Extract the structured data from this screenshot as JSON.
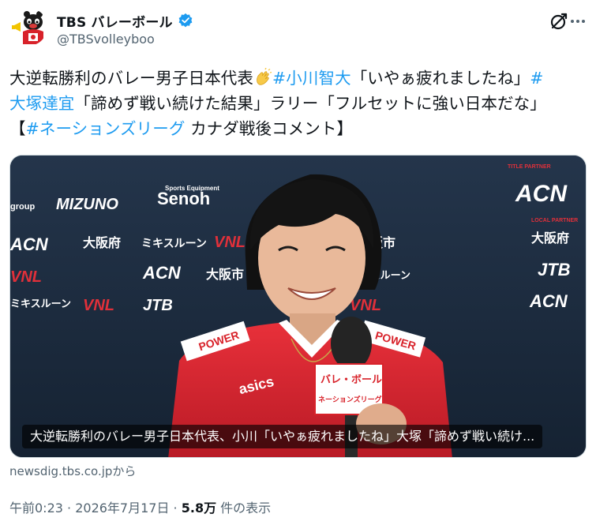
{
  "author": {
    "display_name": "TBS バレーボール",
    "handle": "@TBSvolleyboo",
    "verified_color": "#1d9bf0"
  },
  "tweet": {
    "line1_text": "大逆転勝利のバレー男子日本代表",
    "line1_emoji": "clapping-hands-icon",
    "line1_hashtag": "#小川智大",
    "line1_quote": "「いやぁ疲れましたね」",
    "line1_hashtag_tail": "#",
    "line2_hashtag": "大塚達宜",
    "line2_text": "「諦めず戦い続けた結果」ラリー「フルセットに強い日本だな」",
    "line3_open": "【",
    "line3_hashtag": "#ネーションズリーグ",
    "line3_text": " カナダ戦後コメント】"
  },
  "media": {
    "caption": "大逆転勝利のバレー男子日本代表、小川「いやぁ疲れましたね」大塚「諦めず戦い続け...",
    "sponsors": {
      "mizuno": "MIZUNO",
      "senoh_small": "Sports Equipment",
      "senoh": "Senoh",
      "acn": "ACN",
      "osaka": "大阪府",
      "mikisuru": "ミキスルーン",
      "vnl": "VNL",
      "jtb": "JTB",
      "osaka_city": "大阪市",
      "title_partner": "TITLE PARTNER",
      "local_partner": "LOCAL PARTNER",
      "group": "group"
    },
    "mic_label_1": "バレ・ボール",
    "mic_label_2": "ネーションズリーグ",
    "jersey_power": "POWER",
    "jersey_brand": "asics"
  },
  "source_text": "newsdig.tbs.co.jpから",
  "meta": {
    "time": "午前0:23",
    "separator": " · ",
    "date": "2026年7月17日",
    "views_count": "5.8万",
    "views_label": " 件の表示"
  }
}
